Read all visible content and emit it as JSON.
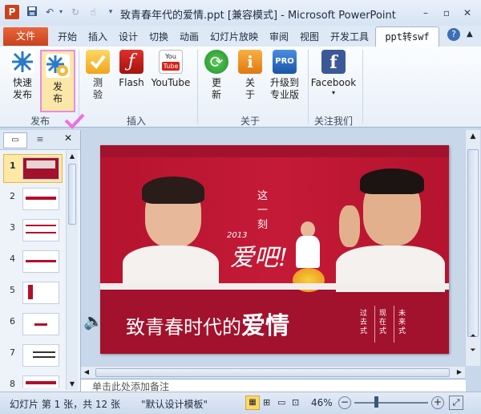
{
  "window": {
    "title": "致青春年代的爱情.ppt [兼容模式] - Microsoft PowerPoint",
    "app_icon": "P"
  },
  "tabs": {
    "file": "文件",
    "items": [
      "开始",
      "插入",
      "设计",
      "切换",
      "动画",
      "幻灯片放映",
      "审阅",
      "视图",
      "开发工具"
    ],
    "active": "ppt转swf"
  },
  "ribbon": {
    "buttons": {
      "quick_publish": "快速\n发布",
      "publish": "发\n布",
      "test": "测\n验",
      "flash": "Flash",
      "youtube": "YouTube",
      "update": "更\n新",
      "about": "关\n于",
      "upgrade": "升级到\n专业版",
      "facebook": "Facebook"
    },
    "groups": {
      "publish": "发布",
      "insert": "插入",
      "about": "关于",
      "follow": "关注我们"
    }
  },
  "slides_pane": {
    "numbers": [
      "1",
      "2",
      "3",
      "4",
      "5",
      "6",
      "7",
      "8"
    ],
    "selected": "1"
  },
  "slide": {
    "title_prefix": "致青春时代的",
    "title_emph": "爱情",
    "side_words": [
      "过去式",
      "现在式",
      "未来式"
    ],
    "vertical_text": "这一刻",
    "script_text": "爱吧!",
    "year": "2013"
  },
  "notes": {
    "placeholder": "单击此处添加备注"
  },
  "status": {
    "slide_info": "幻灯片 第 1 张，共 12 张",
    "theme": "\"默认设计模板\"",
    "zoom": "46%"
  },
  "colors": {
    "accent": "#c8421c",
    "slide_red": "#a2122c"
  }
}
